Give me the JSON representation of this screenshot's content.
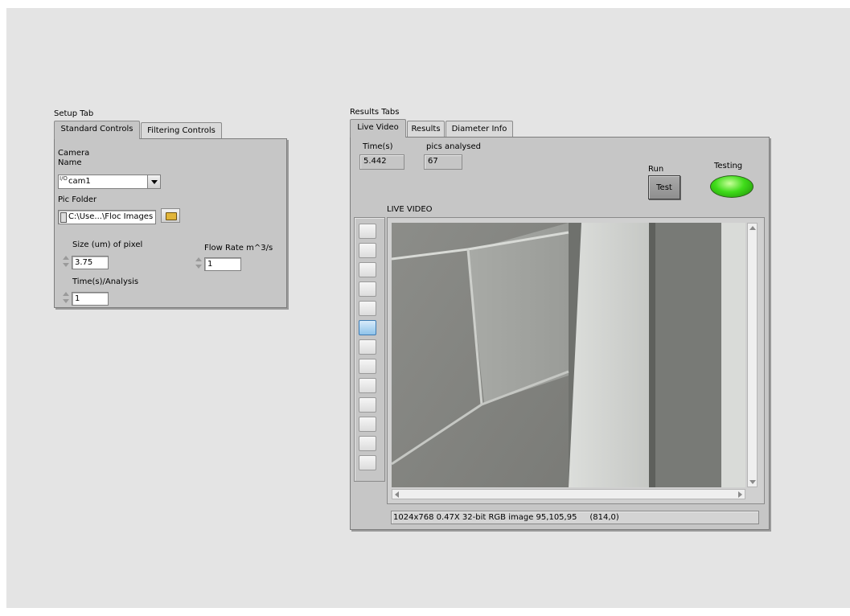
{
  "setup": {
    "title": "Setup Tab",
    "tabs": [
      {
        "label": "Standard Controls",
        "active": true
      },
      {
        "label": "Filtering Controls",
        "active": false
      }
    ],
    "camera_label_line1": "Camera",
    "camera_label_line2": "Name",
    "camera_prefix": "I/O",
    "camera_value": "cam1",
    "pic_folder_label": "Pic Folder",
    "pic_folder_value": "C:\\Use...\\Floc Images",
    "pixel_size_label": "Size (um) of pixel",
    "pixel_size_value": "3.75",
    "flow_rate_label": "Flow Rate m^3/s",
    "flow_rate_value": "1",
    "time_analysis_label": "Time(s)/Analysis",
    "time_analysis_value": "1"
  },
  "results": {
    "title": "Results Tabs",
    "tabs": [
      {
        "label": "Live Video",
        "active": true
      },
      {
        "label": "Results",
        "active": false
      },
      {
        "label": "Diameter Info",
        "active": false
      }
    ],
    "time_label": "Time(s)",
    "time_value": "5.442",
    "pics_label": "pics analysed",
    "pics_value": "67",
    "run_label": "Run",
    "test_button": "Test",
    "testing_label": "Testing",
    "led_color": "#3fdc1a",
    "video_label": "LIVE VIDEO",
    "status_text": "1024x768 0.47X 32-bit RGB image 95,105,95     (814,0)",
    "palette_selected_index": 5,
    "palette_count": 13
  }
}
